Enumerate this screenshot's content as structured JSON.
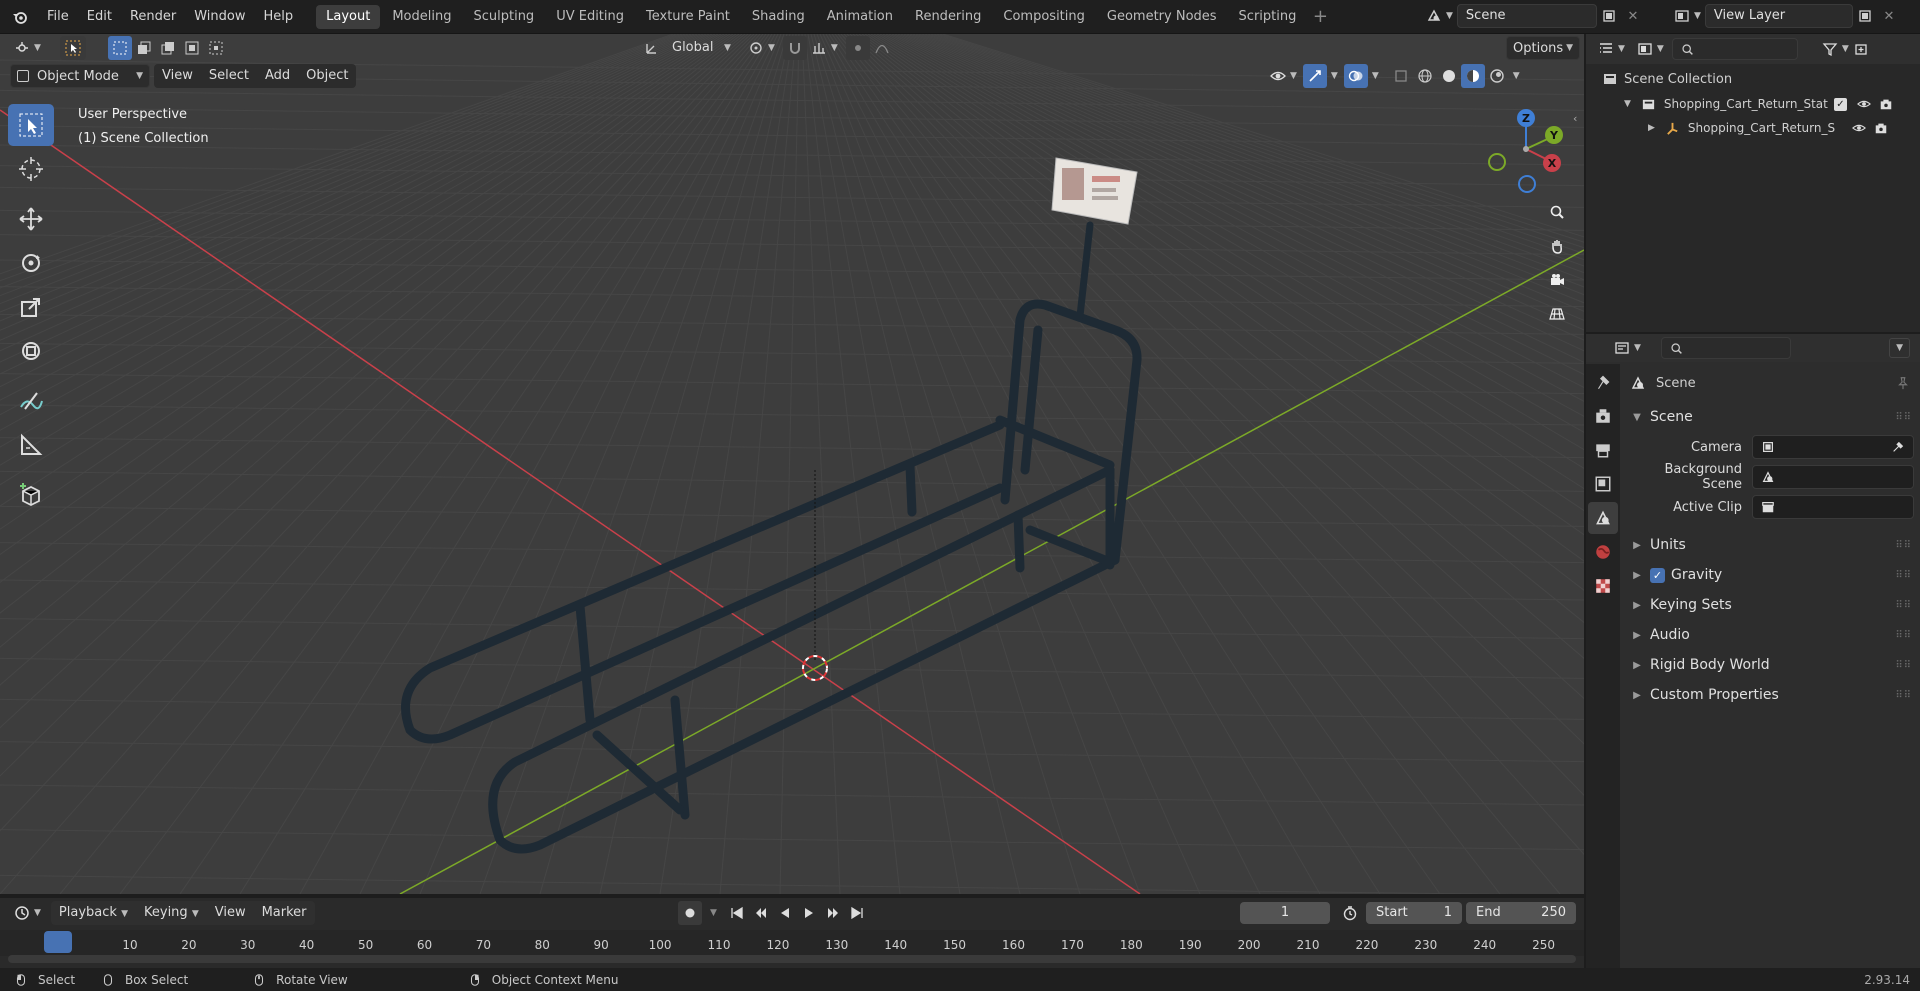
{
  "topbar": {
    "menus": [
      "File",
      "Edit",
      "Render",
      "Window",
      "Help"
    ],
    "workspaces": [
      "Layout",
      "Modeling",
      "Sculpting",
      "UV Editing",
      "Texture Paint",
      "Shading",
      "Animation",
      "Rendering",
      "Compositing",
      "Geometry Nodes",
      "Scripting"
    ],
    "active_workspace": "Layout",
    "scene_name": "Scene",
    "view_layer": "View Layer"
  },
  "viewport": {
    "transform_orientation": "Global",
    "options_label": "Options",
    "mode": "Object Mode",
    "menus": [
      "View",
      "Select",
      "Add",
      "Object"
    ],
    "overlay_line1": "User Perspective",
    "overlay_line2": "(1) Scene Collection",
    "gizmo_axes": {
      "x": "X",
      "y": "Y",
      "z": "Z"
    }
  },
  "outliner": {
    "root": "Scene Collection",
    "items": [
      {
        "label": "Shopping_Cart_Return_Statio",
        "level": 1
      },
      {
        "label": "Shopping_Cart_Return_S",
        "level": 2
      }
    ]
  },
  "properties": {
    "context_title": "Scene",
    "panel_title": "Scene",
    "fields": [
      {
        "label": "Camera",
        "value": ""
      },
      {
        "label": "Background Scene",
        "value": ""
      },
      {
        "label": "Active Clip",
        "value": ""
      }
    ],
    "panels": [
      "Units",
      "Gravity",
      "Keying Sets",
      "Audio",
      "Rigid Body World",
      "Custom Properties"
    ],
    "gravity_checked": true
  },
  "timeline": {
    "menus": [
      "Playback",
      "Keying",
      "View",
      "Marker"
    ],
    "current_frame": "1",
    "start_label": "Start",
    "start_value": "1",
    "end_label": "End",
    "end_value": "250",
    "ruler": [
      "1",
      "10",
      "20",
      "30",
      "40",
      "50",
      "60",
      "70",
      "80",
      "90",
      "100",
      "110",
      "120",
      "130",
      "140",
      "150",
      "160",
      "170",
      "180",
      "190",
      "200",
      "210",
      "220",
      "230",
      "240",
      "250"
    ]
  },
  "statusbar": {
    "hints": [
      "Select",
      "Box Select",
      "Rotate View",
      "Object Context Menu"
    ],
    "version": "2.93.14"
  },
  "colors": {
    "accent": "#4772b3",
    "x_axis": "#c9404a",
    "y_axis": "#7ca928",
    "z_axis": "#3f7fd6",
    "grid_bg": "#3d3d3d"
  }
}
